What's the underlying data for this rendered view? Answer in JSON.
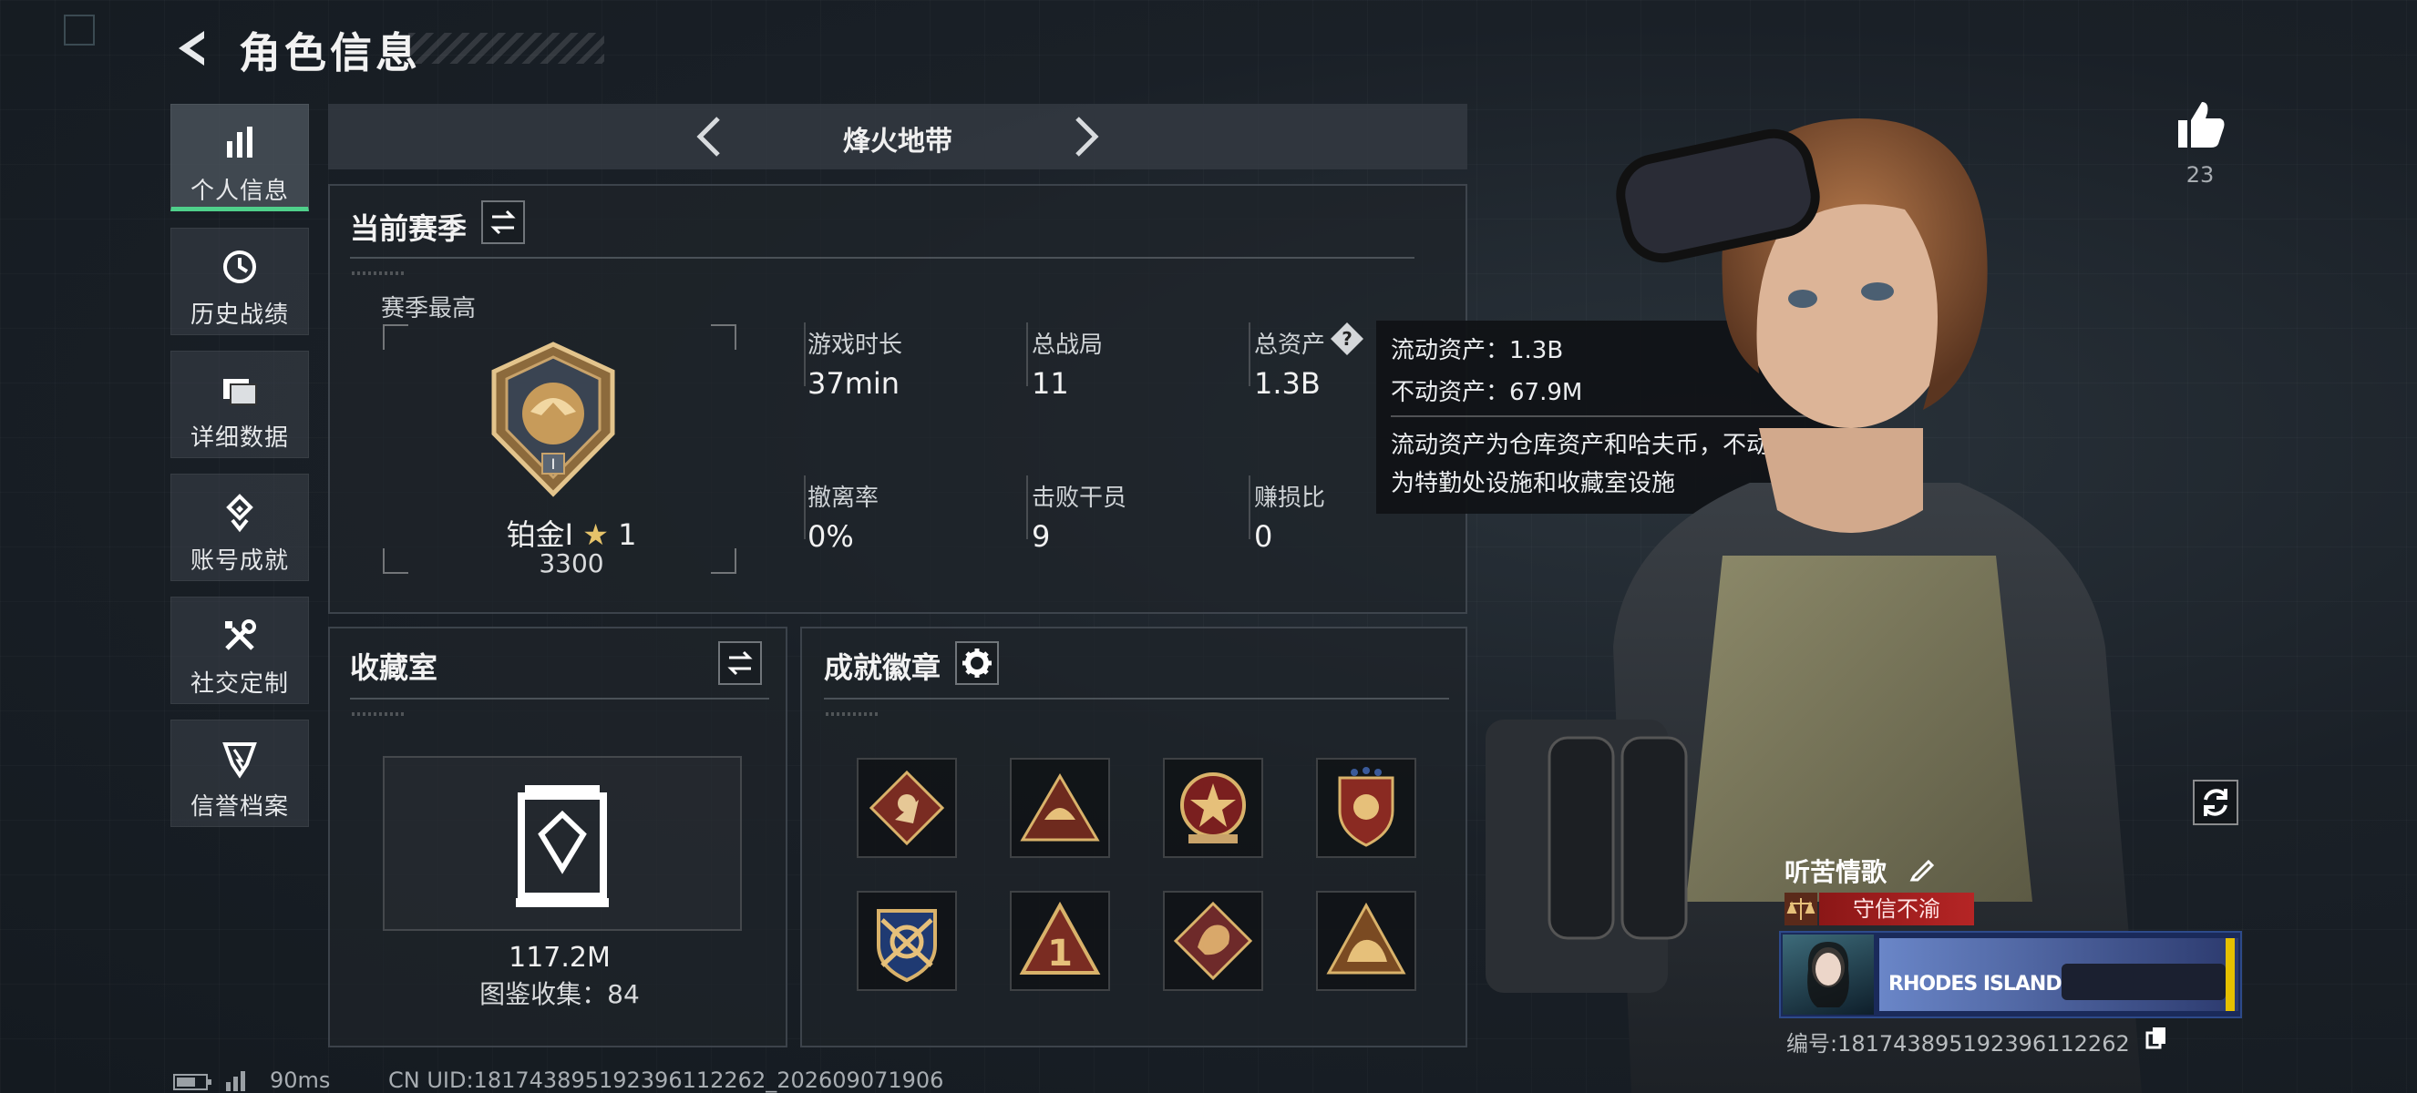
{
  "header": {
    "title": "角色信息"
  },
  "sidebar": {
    "items": [
      {
        "label": "个人信息",
        "icon": "bar-chart-icon",
        "active": true
      },
      {
        "label": "历史战绩",
        "icon": "history-icon",
        "active": false
      },
      {
        "label": "详细数据",
        "icon": "folder-icon",
        "active": false
      },
      {
        "label": "账号成就",
        "icon": "achievement-icon",
        "active": false
      },
      {
        "label": "社交定制",
        "icon": "tools-icon",
        "active": false
      },
      {
        "label": "信誉档案",
        "icon": "credit-icon",
        "active": false
      }
    ]
  },
  "mode": {
    "label": "烽火地带"
  },
  "season": {
    "title": "当前赛季",
    "best_label": "赛季最高",
    "rank_name": "铂金Ⅰ",
    "rank_stars": "1",
    "rank_points": "3300",
    "stats": [
      {
        "label": "游戏时长",
        "value": "37min"
      },
      {
        "label": "总战局",
        "value": "11"
      },
      {
        "label": "总资产",
        "value": "1.3B"
      },
      {
        "label": "撤离率",
        "value": "0%"
      },
      {
        "label": "击败干员",
        "value": "9"
      },
      {
        "label": "赚损比",
        "value": "0"
      }
    ]
  },
  "tooltip": {
    "liquid": "流动资产：1.3B",
    "fixed": "不动资产：67.9M",
    "desc_line1": "流动资产为仓库资产和哈夫币，不动资产",
    "desc_line2": "为特勤处设施和收藏室设施"
  },
  "collection": {
    "title": "收藏室",
    "value": "117.2M",
    "count": "图鉴收集：84"
  },
  "achievements": {
    "title": "成就徽章",
    "badges": [
      "badge-runner-icon",
      "badge-helmet-icon",
      "badge-star-medal-icon",
      "badge-shield-icon",
      "badge-crossed-arrows-icon",
      "badge-number-one-icon",
      "badge-dragon-icon",
      "badge-beast-icon"
    ]
  },
  "likes": {
    "count": "23"
  },
  "profile": {
    "name": "听苦情歌",
    "title_badge": "守信不渝",
    "banner_text": "RHODES ISLAND",
    "uid": "编号:18174389519239611226​2"
  },
  "footer": {
    "ping": "90ms",
    "uid_line": "CN UID:18174389519239611226​2_202609071906"
  },
  "colors": {
    "accent": "#4fd08b",
    "badge_red": "#b52525",
    "panel_bg": "#1e242a"
  }
}
